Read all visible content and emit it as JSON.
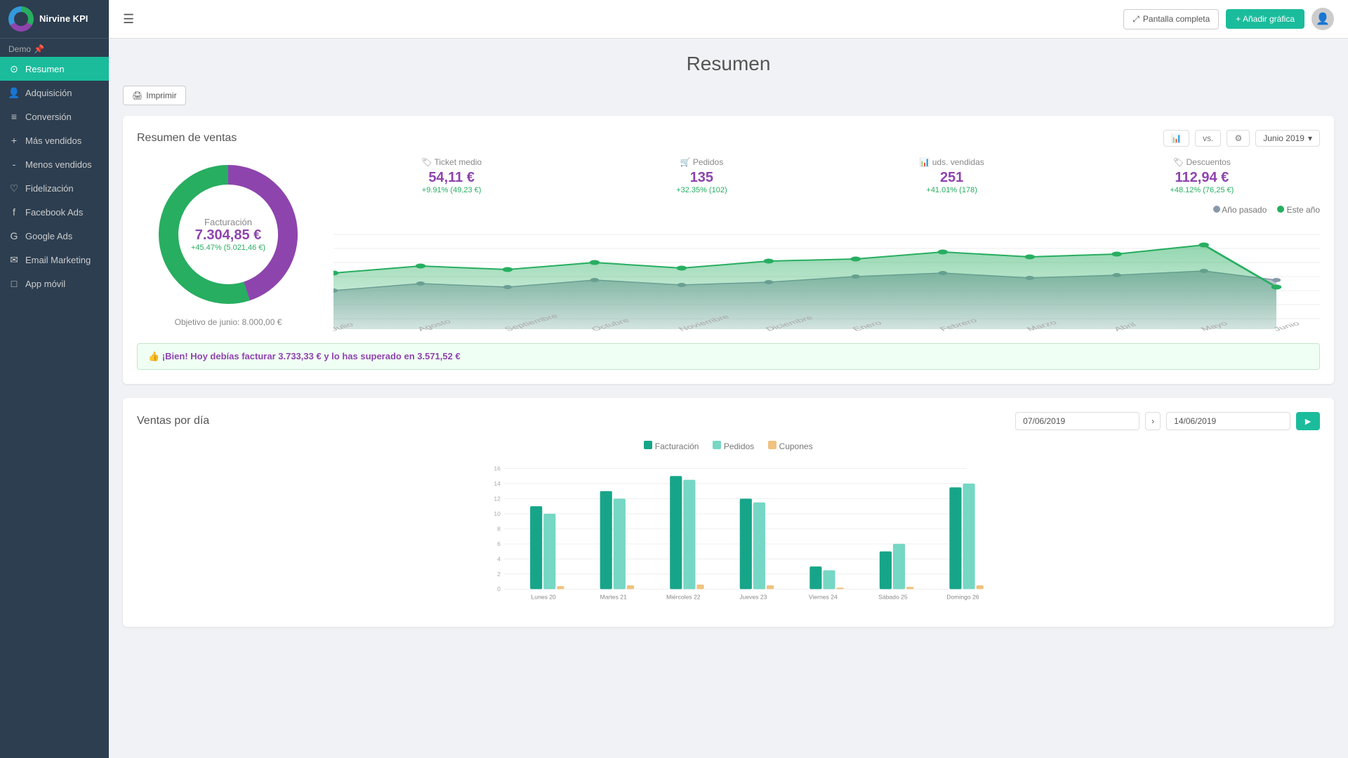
{
  "app": {
    "name": "Nirvine KPI"
  },
  "topbar": {
    "fullscreen_label": "Pantalla completa",
    "add_chart_label": "+ Añadir gráfica"
  },
  "sidebar": {
    "demo_label": "Demo",
    "items": [
      {
        "id": "resumen",
        "label": "Resumen",
        "icon": "⊙",
        "active": true
      },
      {
        "id": "adquisicion",
        "label": "Adquisición",
        "icon": "👤",
        "active": false
      },
      {
        "id": "conversion",
        "label": "Conversión",
        "icon": "≡",
        "active": false
      },
      {
        "id": "mas-vendidos",
        "label": "Más vendidos",
        "icon": "+",
        "active": false
      },
      {
        "id": "menos-vendidos",
        "label": "Menos vendidos",
        "icon": "-",
        "active": false
      },
      {
        "id": "fidelizacion",
        "label": "Fidelización",
        "icon": "♡",
        "active": false
      },
      {
        "id": "facebook-ads",
        "label": "Facebook Ads",
        "icon": "f",
        "active": false
      },
      {
        "id": "google-ads",
        "label": "Google Ads",
        "icon": "G",
        "active": false
      },
      {
        "id": "email-marketing",
        "label": "Email Marketing",
        "icon": "✉",
        "active": false
      },
      {
        "id": "app-movil",
        "label": "App móvil",
        "icon": "□",
        "active": false
      }
    ]
  },
  "page": {
    "title": "Resumen",
    "print_label": "Imprimir"
  },
  "sales_summary": {
    "title": "Resumen de ventas",
    "vs_label": "vs.",
    "date_label": "Junio 2019",
    "facturacion_label": "Facturación",
    "facturacion_value": "7.304,85 €",
    "facturacion_change": "+45.47% (5.021,46 €)",
    "goal_label": "Objetivo de junio: 8.000,00 €",
    "metrics": [
      {
        "label": "Ticket medio",
        "icon": "🏷",
        "value": "54,11 €",
        "change": "+9.91% (49,23 €)"
      },
      {
        "label": "Pedidos",
        "icon": "🛒",
        "value": "135",
        "change": "+32.35% (102)"
      },
      {
        "label": "uds. vendidas",
        "icon": "📊",
        "value": "251",
        "change": "+41.01% (178)"
      },
      {
        "label": "Descuentos",
        "icon": "🏷",
        "value": "112,94 €",
        "change": "+48.12% (76,25 €)"
      }
    ],
    "legend": {
      "past_year": "Año pasado",
      "this_year": "Este año"
    },
    "chart_months": [
      "Julio",
      "Agosto",
      "Septiembre",
      "Octubre",
      "Noviembre",
      "Diciembre",
      "Enero",
      "Febrero",
      "Marzo",
      "Abril",
      "Mayo",
      "Junio"
    ],
    "alert": "¡Bien! Hoy debías facturar 3.733,33 € y lo has superado en 3.571,52 €"
  },
  "ventas_dia": {
    "title": "Ventas por día",
    "date_from": "07/06/2019",
    "date_to": "14/06/2019",
    "legend": {
      "facturacion": "Facturación",
      "pedidos": "Pedidos",
      "cupones": "Cupones"
    },
    "days": [
      {
        "label": "Lunes 20",
        "facturacion": 11,
        "pedidos": 10,
        "cupones": 0.4
      },
      {
        "label": "Martes 21",
        "facturacion": 13,
        "pedidos": 12,
        "cupones": 0.5
      },
      {
        "label": "Miércoles 22",
        "facturacion": 15,
        "pedidos": 14.5,
        "cupones": 0.6
      },
      {
        "label": "Jueves 23",
        "facturacion": 12,
        "pedidos": 11.5,
        "cupones": 0.5
      },
      {
        "label": "Viernes 24",
        "facturacion": 3,
        "pedidos": 2.5,
        "cupones": 0.2
      },
      {
        "label": "Sábado 25",
        "facturacion": 5,
        "pedidos": 6,
        "cupones": 0.3
      },
      {
        "label": "Domingo 26",
        "facturacion": 13.5,
        "pedidos": 14,
        "cupones": 0.5
      }
    ]
  },
  "colors": {
    "green": "#1abc9c",
    "purple": "#8e44ad",
    "blue_dark": "#5d7f9a",
    "teal": "#17a589",
    "light_teal": "#76d7c4",
    "peach": "#f0c27f",
    "gray_area": "#8898aa"
  }
}
